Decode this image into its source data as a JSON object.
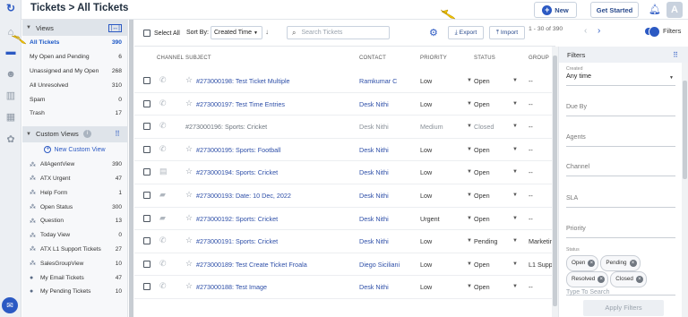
{
  "header": {
    "title": "Tickets > All Tickets",
    "new_label": "New",
    "get_started_label": "Get Started",
    "avatar_letter": "A"
  },
  "sidebar": {
    "views_title": "Views",
    "views": [
      {
        "label": "All Tickets",
        "count": "390",
        "active": true
      },
      {
        "label": "My Open and Pending",
        "count": "6"
      },
      {
        "label": "Unassigned and My Open",
        "count": "268"
      },
      {
        "label": "All Unresolved",
        "count": "310"
      },
      {
        "label": "Spam",
        "count": "0"
      },
      {
        "label": "Trash",
        "count": "17"
      }
    ],
    "custom_views_title": "Custom Views",
    "new_custom_view_label": "New Custom View",
    "custom_views": [
      {
        "label": "AllAgentView",
        "count": "390"
      },
      {
        "label": "ATX Urgent",
        "count": "47"
      },
      {
        "label": "Help Form",
        "count": "1"
      },
      {
        "label": "Open Status",
        "count": "300"
      },
      {
        "label": "Question",
        "count": "13"
      },
      {
        "label": "Today View",
        "count": "0"
      },
      {
        "label": "ATX L1 Support Tickets",
        "count": "27"
      },
      {
        "label": "SalesGroupView",
        "count": "10"
      },
      {
        "label": "My Email Tickets",
        "count": "47"
      },
      {
        "label": "My Pending Tickets",
        "count": "10"
      }
    ]
  },
  "toolbar": {
    "select_all_label": "Select All",
    "sort_by_label": "Sort By:",
    "sort_value": "Created Time",
    "search_placeholder": "Search Tickets",
    "export_label": "Export",
    "import_label": "Import",
    "pagination": "1 - 30 of 390",
    "filters_label": "Filters"
  },
  "table": {
    "columns": [
      "CHANNEL",
      "SUBJECT",
      "CONTACT",
      "PRIORITY",
      "STATUS",
      "GROUP"
    ],
    "rows": [
      {
        "subject": "#273000198: Test Ticket Multiple",
        "contact": "Ramkumar C",
        "priority": "Low",
        "status": "Open",
        "group": "--",
        "link": true,
        "channel": "phone-icon"
      },
      {
        "subject": "#273000197: Test Time Entries",
        "contact": "Desk Nithi",
        "priority": "Low",
        "status": "Open",
        "group": "--",
        "link": true,
        "channel": "phone-icon"
      },
      {
        "subject": "#273000196: Sports: Cricket",
        "contact": "Desk Nithi",
        "priority": "Medium",
        "status": "Closed",
        "group": "--",
        "link": false,
        "channel": "phone-icon"
      },
      {
        "subject": "#273000195: Sports: Football",
        "contact": "Desk Nithi",
        "priority": "Low",
        "status": "Open",
        "group": "--",
        "link": true,
        "channel": "phone-icon"
      },
      {
        "subject": "#273000194: Sports: Cricket",
        "contact": "Desk Nithi",
        "priority": "Low",
        "status": "Open",
        "group": "--",
        "link": true,
        "channel": "form-icon"
      },
      {
        "subject": "#273000193: Date: 10 Dec, 2022",
        "contact": "Desk Nithi",
        "priority": "Low",
        "status": "Open",
        "group": "--",
        "link": true,
        "channel": "chat-icon"
      },
      {
        "subject": "#273000192: Sports: Cricket",
        "contact": "Desk Nithi",
        "priority": "Urgent",
        "status": "Open",
        "group": "--",
        "link": true,
        "channel": "chat-icon"
      },
      {
        "subject": "#273000191: Sports: Cricket",
        "contact": "Desk Nithi",
        "priority": "Low",
        "status": "Pending",
        "group": "Marketin",
        "link": true,
        "channel": "phone-icon"
      },
      {
        "subject": "#273000189: Test Create Ticket Froala",
        "contact": "Diego Siciliani",
        "priority": "Low",
        "status": "Open",
        "group": "L1 Supp",
        "link": true,
        "channel": "phone-icon"
      },
      {
        "subject": "#273000188: Test Image",
        "contact": "Desk Nithi",
        "priority": "Low",
        "status": "Open",
        "group": "--",
        "link": true,
        "channel": "phone-icon"
      }
    ]
  },
  "filters": {
    "title": "Filters",
    "created_label": "Created",
    "created_value": "Any time",
    "due_by": "Due By",
    "agents": "Agents",
    "channel": "Channel",
    "sla": "SLA",
    "priority": "Priority",
    "status_label": "Status",
    "status_tags": [
      "Open",
      "Pending",
      "Resolved",
      "Closed"
    ],
    "status_placeholder": "Type To Search",
    "apply_label": "Apply Filters"
  },
  "colors": {
    "accent": "#2b59c3",
    "link": "#2e4fa8",
    "annotation": "#f2c200"
  }
}
